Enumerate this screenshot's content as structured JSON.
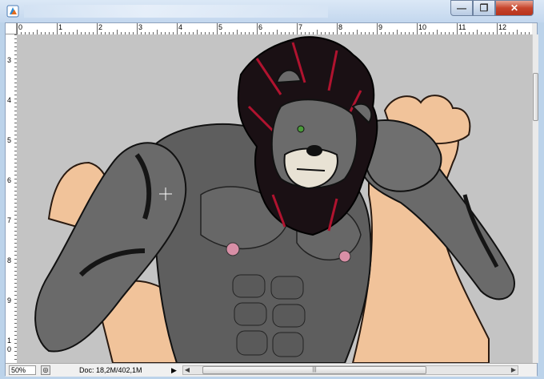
{
  "window": {
    "title": "",
    "controls": {
      "minimize": "—",
      "maximize": "❐",
      "close": "✕"
    }
  },
  "rulers": {
    "top_labels": [
      "0",
      "1",
      "2",
      "3",
      "4",
      "5",
      "6",
      "7",
      "8",
      "9",
      "10",
      "11",
      "12"
    ],
    "left_labels": [
      "3",
      "4",
      "5",
      "6",
      "7",
      "8",
      "9",
      "1",
      "0"
    ]
  },
  "status_bar": {
    "zoom": "50%",
    "doc_info": "Doc: 18,2M/402,1M",
    "scroll_grip": "|||"
  },
  "colors": {
    "canvas_bg": "#c4c4c4",
    "skin": "#f1c39a",
    "fur": "#6a6a6a",
    "mane_black": "#1a1014",
    "mane_red": "#b0132f"
  },
  "icons": [
    "photoshop-app-icon",
    "zoom-options-icon",
    "play-arrow-icon",
    "scroll-left-icon",
    "scroll-right-icon"
  ]
}
